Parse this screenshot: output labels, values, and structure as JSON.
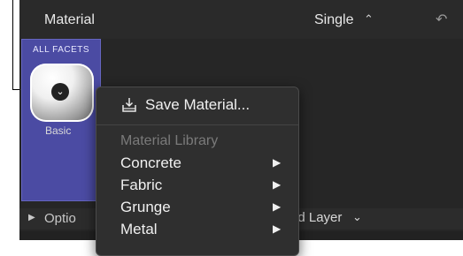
{
  "header": {
    "title": "Material",
    "mode_value": "Single",
    "mode_chevron": "⌃⌄",
    "undo_icon": "undo-arrow-icon"
  },
  "facets": {
    "label": "ALL FACETS",
    "material_name": "Basic",
    "menu_button_icon": "chevron-down-icon"
  },
  "context_menu": {
    "save_label": "Save Material...",
    "save_icon": "save-tray-icon",
    "library_header": "Material Library",
    "items": [
      {
        "label": "Concrete",
        "arrow": "▶"
      },
      {
        "label": "Fabric",
        "arrow": "▶"
      },
      {
        "label": "Grunge",
        "arrow": "▶"
      },
      {
        "label": "Metal",
        "arrow": "▶"
      }
    ]
  },
  "bottom_bar": {
    "options_label": "Optio",
    "add_layer_label": "Add Layer",
    "add_layer_chevron": "⌄"
  }
}
